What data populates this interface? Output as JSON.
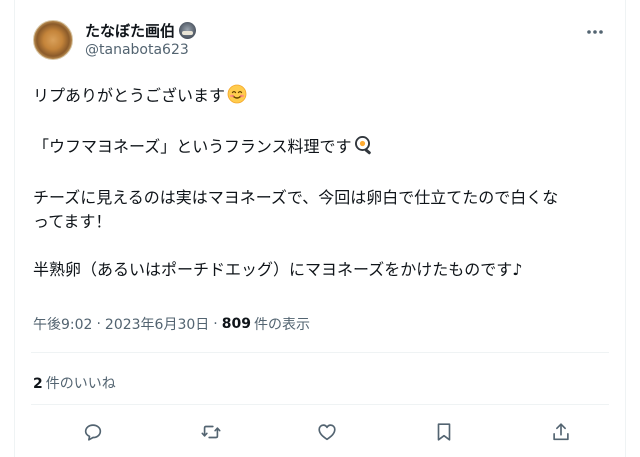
{
  "post": {
    "author": {
      "display_name": "たなぼた画伯",
      "handle": "@tanabota623"
    },
    "body": {
      "line1": "リプありがとうございます",
      "line2": "「ウフマヨネーズ」というフランス料理です",
      "line3a": "チーズに見えるのは実はマヨネーズで、今回は卵白で仕立てたので白くな",
      "line3b": "ってます！",
      "line4": "半熟卵（あるいはポーチドエッグ）にマヨネーズをかけたものです♪"
    },
    "emojis": [
      "smiling-face-emoji",
      "frying-pan-egg-emoji"
    ],
    "meta": {
      "time": "午後9:02",
      "date": "2023年6月30日",
      "views_count": "809",
      "views_label": "件の表示",
      "separator": "·"
    },
    "likes": {
      "count": "2",
      "label": "件のいいね"
    },
    "actions": [
      "reply-icon",
      "repost-icon",
      "like-icon",
      "bookmark-icon",
      "share-icon"
    ]
  },
  "colors": {
    "text_primary": "#0f1419",
    "text_secondary": "#536471",
    "border": "#eff3f4",
    "icon": "#536471"
  }
}
